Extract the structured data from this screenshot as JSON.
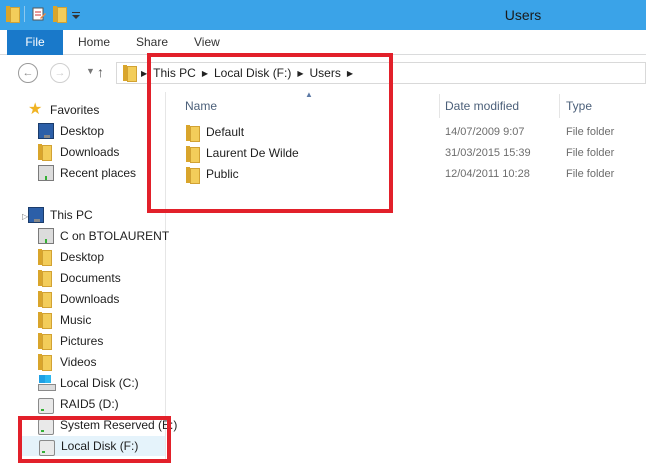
{
  "window": {
    "title": "Users"
  },
  "quick_access": {
    "icons": [
      "folder-icon",
      "properties-icon",
      "new-folder-icon",
      "customize-dropdown-icon"
    ]
  },
  "ribbon": {
    "file": "File",
    "tabs": [
      "Home",
      "Share",
      "View"
    ]
  },
  "address": {
    "crumbs": [
      "This PC",
      "Local Disk (F:)",
      "Users"
    ]
  },
  "sidebar": {
    "favorites_label": "Favorites",
    "favorites": [
      "Desktop",
      "Downloads",
      "Recent places"
    ],
    "thispc_label": "This PC",
    "thispc_items": [
      "C on BTOLAURENT",
      "Desktop",
      "Documents",
      "Downloads",
      "Music",
      "Pictures",
      "Videos",
      "Local Disk (C:)",
      "RAID5 (D:)",
      "System Reserved (E:)",
      "Local Disk (F:)"
    ]
  },
  "columns": {
    "name": "Name",
    "date": "Date modified",
    "type": "Type"
  },
  "files": [
    {
      "name": "Default",
      "date": "14/07/2009 9:07",
      "type": "File folder"
    },
    {
      "name": "Laurent De Wilde",
      "date": "31/03/2015 15:39",
      "type": "File folder"
    },
    {
      "name": "Public",
      "date": "12/04/2011 10:28",
      "type": "File folder"
    }
  ],
  "colors": {
    "titlebar": "#3aa3e8",
    "file_tab": "#1979ca",
    "annotation": "#e2202a",
    "selected": "#e5f3fb"
  }
}
